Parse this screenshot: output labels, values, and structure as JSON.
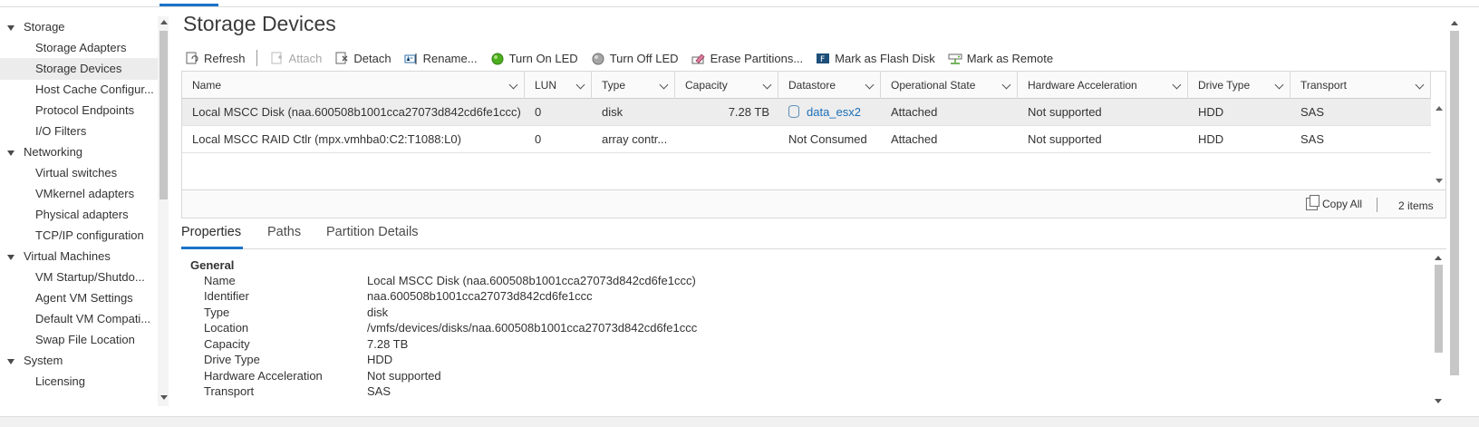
{
  "sidebar": {
    "items": [
      {
        "label": "Storage",
        "type": "group"
      },
      {
        "label": "Storage Adapters",
        "type": "child"
      },
      {
        "label": "Storage Devices",
        "type": "child",
        "selected": true
      },
      {
        "label": "Host Cache Configur...",
        "type": "child"
      },
      {
        "label": "Protocol Endpoints",
        "type": "child"
      },
      {
        "label": "I/O Filters",
        "type": "child"
      },
      {
        "label": "Networking",
        "type": "group"
      },
      {
        "label": "Virtual switches",
        "type": "child"
      },
      {
        "label": "VMkernel adapters",
        "type": "child"
      },
      {
        "label": "Physical adapters",
        "type": "child"
      },
      {
        "label": "TCP/IP configuration",
        "type": "child"
      },
      {
        "label": "Virtual Machines",
        "type": "group"
      },
      {
        "label": "VM Startup/Shutdo...",
        "type": "child"
      },
      {
        "label": "Agent VM Settings",
        "type": "child"
      },
      {
        "label": "Default VM Compati...",
        "type": "child"
      },
      {
        "label": "Swap File Location",
        "type": "child"
      },
      {
        "label": "System",
        "type": "group"
      },
      {
        "label": "Licensing",
        "type": "child"
      }
    ]
  },
  "page": {
    "title": "Storage Devices"
  },
  "toolbar": {
    "refresh": "Refresh",
    "attach": "Attach",
    "detach": "Detach",
    "rename": "Rename...",
    "turn_on_led": "Turn On LED",
    "turn_off_led": "Turn Off LED",
    "erase_partitions": "Erase Partitions...",
    "mark_flash": "Mark as Flash Disk",
    "mark_remote": "Mark as Remote"
  },
  "grid": {
    "columns": [
      "Name",
      "LUN",
      "Type",
      "Capacity",
      "Datastore",
      "Operational State",
      "Hardware Acceleration",
      "Drive Type",
      "Transport"
    ],
    "rows": [
      {
        "name": "Local MSCC Disk (naa.600508b1001cca27073d842cd6fe1ccc)",
        "lun": "0",
        "type": "disk",
        "capacity": "7.28 TB",
        "datastore": "data_esx2",
        "operational_state": "Attached",
        "hardware_acceleration": "Not supported",
        "drive_type": "HDD",
        "transport": "SAS"
      },
      {
        "name": "Local MSCC RAID Ctlr (mpx.vmhba0:C2:T1088:L0)",
        "lun": "0",
        "type": "array contr...",
        "capacity": "",
        "datastore": "Not Consumed",
        "operational_state": "Attached",
        "hardware_acceleration": "Not supported",
        "drive_type": "HDD",
        "transport": "SAS"
      }
    ],
    "footer": {
      "copy_all": "Copy All",
      "count": "2 items"
    }
  },
  "details": {
    "tabs": [
      "Properties",
      "Paths",
      "Partition Details"
    ],
    "active_tab": "Properties",
    "section": "General",
    "properties": [
      {
        "label": "Name",
        "value": "Local MSCC Disk (naa.600508b1001cca27073d842cd6fe1ccc)"
      },
      {
        "label": "Identifier",
        "value": "naa.600508b1001cca27073d842cd6fe1ccc"
      },
      {
        "label": "Type",
        "value": "disk"
      },
      {
        "label": "Location",
        "value": "/vmfs/devices/disks/naa.600508b1001cca27073d842cd6fe1ccc"
      },
      {
        "label": "Capacity",
        "value": "7.28 TB"
      },
      {
        "label": "Drive Type",
        "value": "HDD"
      },
      {
        "label": "Hardware Acceleration",
        "value": "Not supported"
      },
      {
        "label": "Transport",
        "value": "SAS"
      }
    ]
  },
  "colors": {
    "accent": "#1a73c8",
    "link": "#1a6fb8",
    "led_on": "#4cae1f",
    "led_off": "#8a8a8a"
  }
}
